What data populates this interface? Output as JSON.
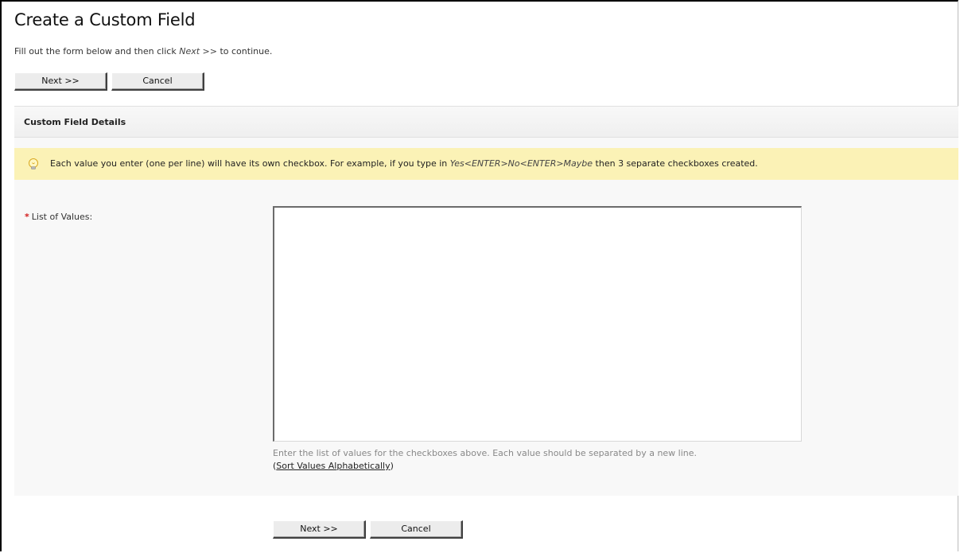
{
  "page": {
    "title": "Create a Custom Field",
    "intro_prefix": "Fill out the form below and then click ",
    "intro_emphasis": "Next >>",
    "intro_suffix": " to continue."
  },
  "top_actions": {
    "next_label": "Next >>",
    "cancel_label": "Cancel"
  },
  "section": {
    "title": "Custom Field Details"
  },
  "hint": {
    "icon": "lightbulb-icon",
    "text_prefix": "Each value you enter (one per line) will have its own checkbox. For example, if you type in ",
    "example": "Yes<ENTER>No<ENTER>Maybe",
    "text_suffix": " then 3 separate checkboxes created.",
    "background_color": "#fbf2b6"
  },
  "form": {
    "required_marker": "*",
    "values_label": "List of Values:",
    "values_value": "",
    "help_text": "Enter the list of values for the checkboxes above. Each value should be separated by a new line.",
    "sort_open": "(",
    "sort_link": "Sort Values Alphabetically",
    "sort_close": ")"
  },
  "bottom_actions": {
    "next_label": "Next >>",
    "cancel_label": "Cancel"
  }
}
